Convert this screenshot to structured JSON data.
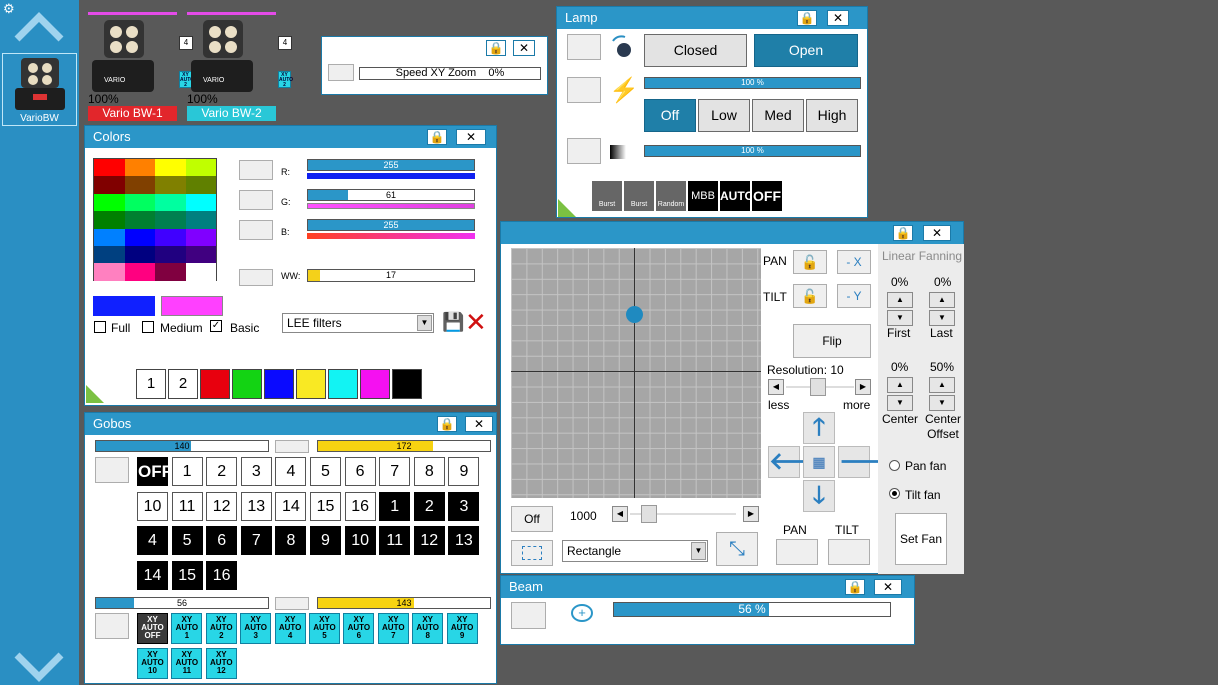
{
  "sidebar": {
    "selected_fixture_label": "VarioBW"
  },
  "fixtures": [
    {
      "name": "Vario BW-1",
      "percent": "100%",
      "badge": "4",
      "xy": "XY AUTO 2",
      "color": "#e2262b"
    },
    {
      "name": "Vario BW-2",
      "percent": "100%",
      "badge": "4",
      "xy": "XY AUTO 2",
      "color": "#29c7d7"
    }
  ],
  "speed": {
    "label": "Speed XY Zoom",
    "value": "0%"
  },
  "lamp": {
    "title": "Lamp",
    "closed": "Closed",
    "open": "Open",
    "bar1": "100 %",
    "levels": [
      "Off",
      "Low",
      "Med",
      "High"
    ],
    "bar2": "100 %",
    "effects": [
      "Burst",
      "Burst",
      "Random",
      "MBB",
      "AUTO",
      "OFF"
    ]
  },
  "colors": {
    "title": "Colors",
    "palette": [
      [
        "#ff0000",
        "#ff8000",
        "#ffff00",
        "#c0ff00"
      ],
      [
        "#800000",
        "#804000",
        "#808000",
        "#608000"
      ],
      [
        "#00ff00",
        "#00ff60",
        "#00ffa0",
        "#00ffff"
      ],
      [
        "#008000",
        "#008030",
        "#008050",
        "#008080"
      ],
      [
        "#0080ff",
        "#0000ff",
        "#4000ff",
        "#8000ff"
      ],
      [
        "#004080",
        "#000080",
        "#200080",
        "#400080"
      ],
      [
        "#ff80c0",
        "#ff0080",
        "#800040",
        "#ffffff"
      ]
    ],
    "r": {
      "label": "R:",
      "value": "255"
    },
    "g": {
      "label": "G:",
      "value": "61"
    },
    "b": {
      "label": "B:",
      "value": "255"
    },
    "ww": {
      "label": "WW:",
      "value": "17"
    },
    "opt_full": "Full",
    "opt_medium": "Medium",
    "opt_basic": "Basic",
    "filter": "LEE filters",
    "presets": [
      "1",
      "2"
    ],
    "preset_colors": [
      "#e8000e",
      "#13d313",
      "#0a0aff",
      "#f9e923",
      "#12f3f3",
      "#f510f1",
      "#000000"
    ]
  },
  "gobos": {
    "title": "Gobos",
    "bar1": "140",
    "bar2": "172",
    "off": "OFF",
    "white": [
      "1",
      "2",
      "3",
      "4",
      "5",
      "6",
      "7",
      "8",
      "9",
      "10",
      "11",
      "12",
      "13",
      "14",
      "15",
      "16"
    ],
    "black": [
      "1",
      "2",
      "3",
      "4",
      "5",
      "6",
      "7",
      "8",
      "9",
      "10",
      "11",
      "12",
      "13",
      "14",
      "15",
      "16"
    ],
    "bar3": "56",
    "bar4": "143",
    "xy": [
      "XY AUTO OFF",
      "XY AUTO 1",
      "XY AUTO 2",
      "XY AUTO 3",
      "XY AUTO 4",
      "XY AUTO 5",
      "XY AUTO 6",
      "XY AUTO 7",
      "XY AUTO 8",
      "XY AUTO 9",
      "XY AUTO 10",
      "XY AUTO 11",
      "XY AUTO 12"
    ]
  },
  "position": {
    "pan": "PAN",
    "tilt": "TILT",
    "minus_x": "- X",
    "minus_y": "- Y",
    "flip": "Flip",
    "resolution": "Resolution: 10",
    "less": "less",
    "more": "more",
    "off": "Off",
    "speed_value": "1000",
    "shape": "Rectangle",
    "pan_btn": "PAN",
    "tilt_btn": "TILT",
    "fan_title": "Linear Fanning",
    "first_pct": "0%",
    "last_pct": "0%",
    "first": "First",
    "last": "Last",
    "center_pct": "0%",
    "offset_pct": "50%",
    "center": "Center",
    "center_offset": "Center Offset",
    "pan_fan": "Pan fan",
    "tilt_fan": "Tilt fan",
    "set_fan": "Set Fan"
  },
  "beam": {
    "title": "Beam",
    "value": "56 %"
  }
}
